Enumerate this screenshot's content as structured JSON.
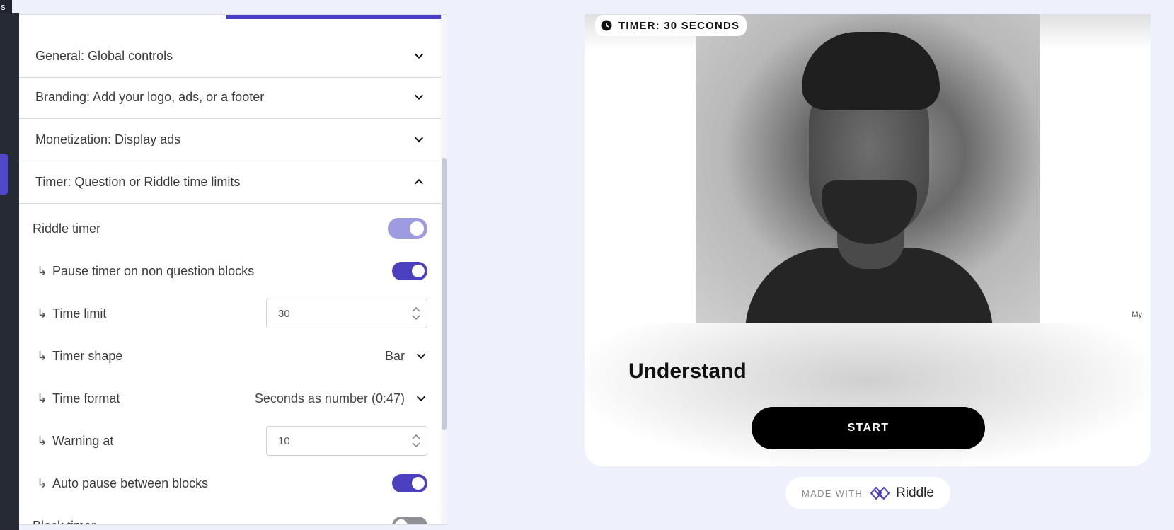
{
  "corner_tag": "s",
  "accordion": [
    {
      "label": "General: Global controls",
      "expanded": false
    },
    {
      "label": "Branding: Add your logo, ads, or a footer",
      "expanded": false
    },
    {
      "label": "Monetization: Display ads",
      "expanded": false
    },
    {
      "label": "Timer: Question or Riddle time limits",
      "expanded": true
    }
  ],
  "timer_settings": {
    "riddle_timer": {
      "label": "Riddle timer",
      "enabled": true
    },
    "pause_timer": {
      "arrow": "↳",
      "label": "Pause timer on non question blocks",
      "enabled": true
    },
    "time_limit": {
      "arrow": "↳",
      "label": "Time limit",
      "value": "30"
    },
    "timer_shape": {
      "arrow": "↳",
      "label": "Timer shape",
      "value": "Bar"
    },
    "time_format": {
      "arrow": "↳",
      "label": "Time format",
      "value": "Seconds as number (0:47)"
    },
    "warning_at": {
      "arrow": "↳",
      "label": "Warning at",
      "value": "10"
    },
    "auto_pause": {
      "arrow": "↳",
      "label": "Auto pause between blocks",
      "enabled": true
    },
    "block_timer": {
      "label": "Block timer",
      "enabled": false
    }
  },
  "preview": {
    "timer_badge": "TIMER: 30 SECONDS",
    "side_label": "My",
    "title": "Understand",
    "start_button": "START"
  },
  "made_with": {
    "prefix": "MADE WITH",
    "brand": "Riddle"
  },
  "colors": {
    "accent": "#4a40c0",
    "accent_light": "#9f9be0",
    "page_bg": "#eef1fc",
    "toggle_off": "#8f9196"
  }
}
